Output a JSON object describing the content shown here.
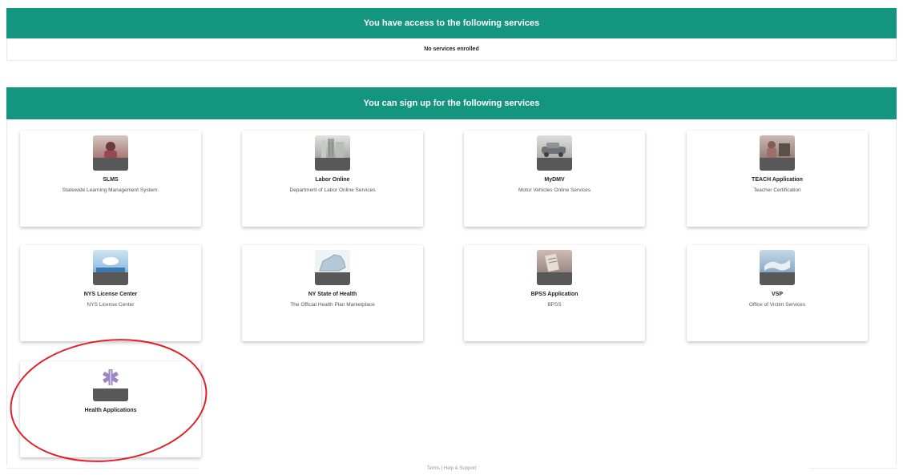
{
  "access": {
    "header": "You have access to the following services",
    "empty_text": "No services enrolled"
  },
  "signup": {
    "header": "You can sign up for the following services",
    "services": [
      {
        "title": "SLMS",
        "description": "Statewide Learning Management System.",
        "icon": "person-at-desk-photo-icon",
        "colors": [
          "#c9b8b4",
          "#8a4a52"
        ]
      },
      {
        "title": "Labor Online",
        "description": "Department of Labor Online Services",
        "icon": "building-photo-icon",
        "colors": [
          "#d8d8d4",
          "#8f948f"
        ]
      },
      {
        "title": "MyDMV",
        "description": "Motor Vehicles Online Services",
        "icon": "car-photo-icon",
        "colors": [
          "#d6d3cf",
          "#7d8185"
        ]
      },
      {
        "title": "TEACH Application",
        "description": "Teacher Certification",
        "icon": "classroom-photo-icon",
        "colors": [
          "#c6b1a8",
          "#6a5c57"
        ]
      },
      {
        "title": "NYS License Center",
        "description": "NYS License Center",
        "icon": "landscape-photo-icon",
        "colors": [
          "#9fc7e4",
          "#4a86b9"
        ]
      },
      {
        "title": "NY State of Health",
        "description": "The Official Health Plan Marketplace",
        "icon": "new-york-map-icon",
        "colors": [
          "#e7eef3",
          "#9fb9cb"
        ]
      },
      {
        "title": "BPSS Application",
        "description": "BPSS",
        "icon": "document-photo-icon",
        "colors": [
          "#c9b2a9",
          "#7b6c66"
        ]
      },
      {
        "title": "VSP",
        "description": "Office of Victim Services",
        "icon": "handshake-photo-icon",
        "colors": [
          "#a8c3da",
          "#5d7f9e"
        ]
      },
      {
        "title": "Health Applications",
        "description": "",
        "icon": "star-of-life-icon",
        "colors": [
          "#ffffff",
          "#ffffff"
        ]
      }
    ]
  },
  "footer": {
    "text": "Terms | Help & Support"
  },
  "annotation_color": "#e0202a",
  "brand_color": "#14957f"
}
